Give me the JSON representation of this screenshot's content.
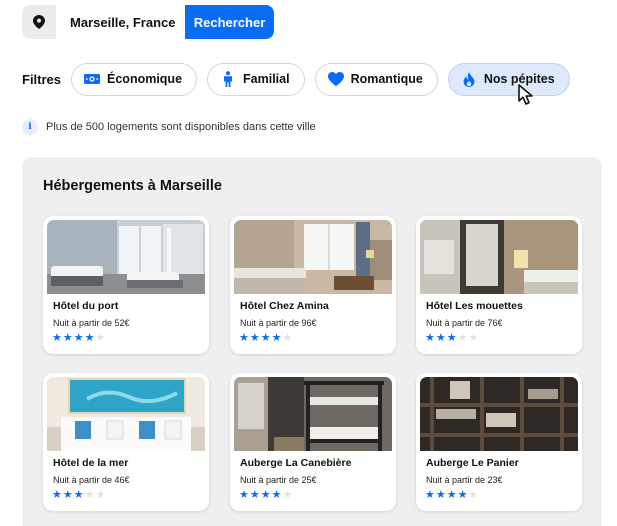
{
  "search": {
    "value": "Marseille, France",
    "button_label": "Rechercher",
    "pin_icon": "location-pin-icon"
  },
  "filters": {
    "label": "Filtres",
    "items": [
      {
        "label": "Économique",
        "icon": "money-icon",
        "active": false
      },
      {
        "label": "Familial",
        "icon": "person-icon",
        "active": false
      },
      {
        "label": "Romantique",
        "icon": "heart-icon",
        "active": false
      },
      {
        "label": "Nos pépites",
        "icon": "flame-icon",
        "active": true
      }
    ]
  },
  "info": {
    "icon": "info-icon",
    "text": "Plus de 500 logements sont disponibles dans cette ville"
  },
  "panel": {
    "title": "Hébergements à Marseille",
    "cards": [
      {
        "name": "Hôtel du port",
        "price": "Nuit à partir de 52€",
        "rating": 4,
        "max": 5
      },
      {
        "name": "Hôtel Chez Amina",
        "price": "Nuit à partir de 96€",
        "rating": 4,
        "max": 5
      },
      {
        "name": "Hôtel Les mouettes",
        "price": "Nuit à partir de 76€",
        "rating": 3,
        "max": 5
      },
      {
        "name": "Hôtel de la mer",
        "price": "Nuit à partir de 46€",
        "rating": 3,
        "max": 5
      },
      {
        "name": "Auberge La Canebière",
        "price": "Nuit à partir de 25€",
        "rating": 4,
        "max": 5
      },
      {
        "name": "Auberge Le Panier",
        "price": "Nuit à partir de 23€",
        "rating": 4,
        "max": 5
      }
    ]
  },
  "colors": {
    "accent": "#0a6cf5",
    "active_chip": "#dde9fb",
    "panel_bg": "#efefef"
  }
}
